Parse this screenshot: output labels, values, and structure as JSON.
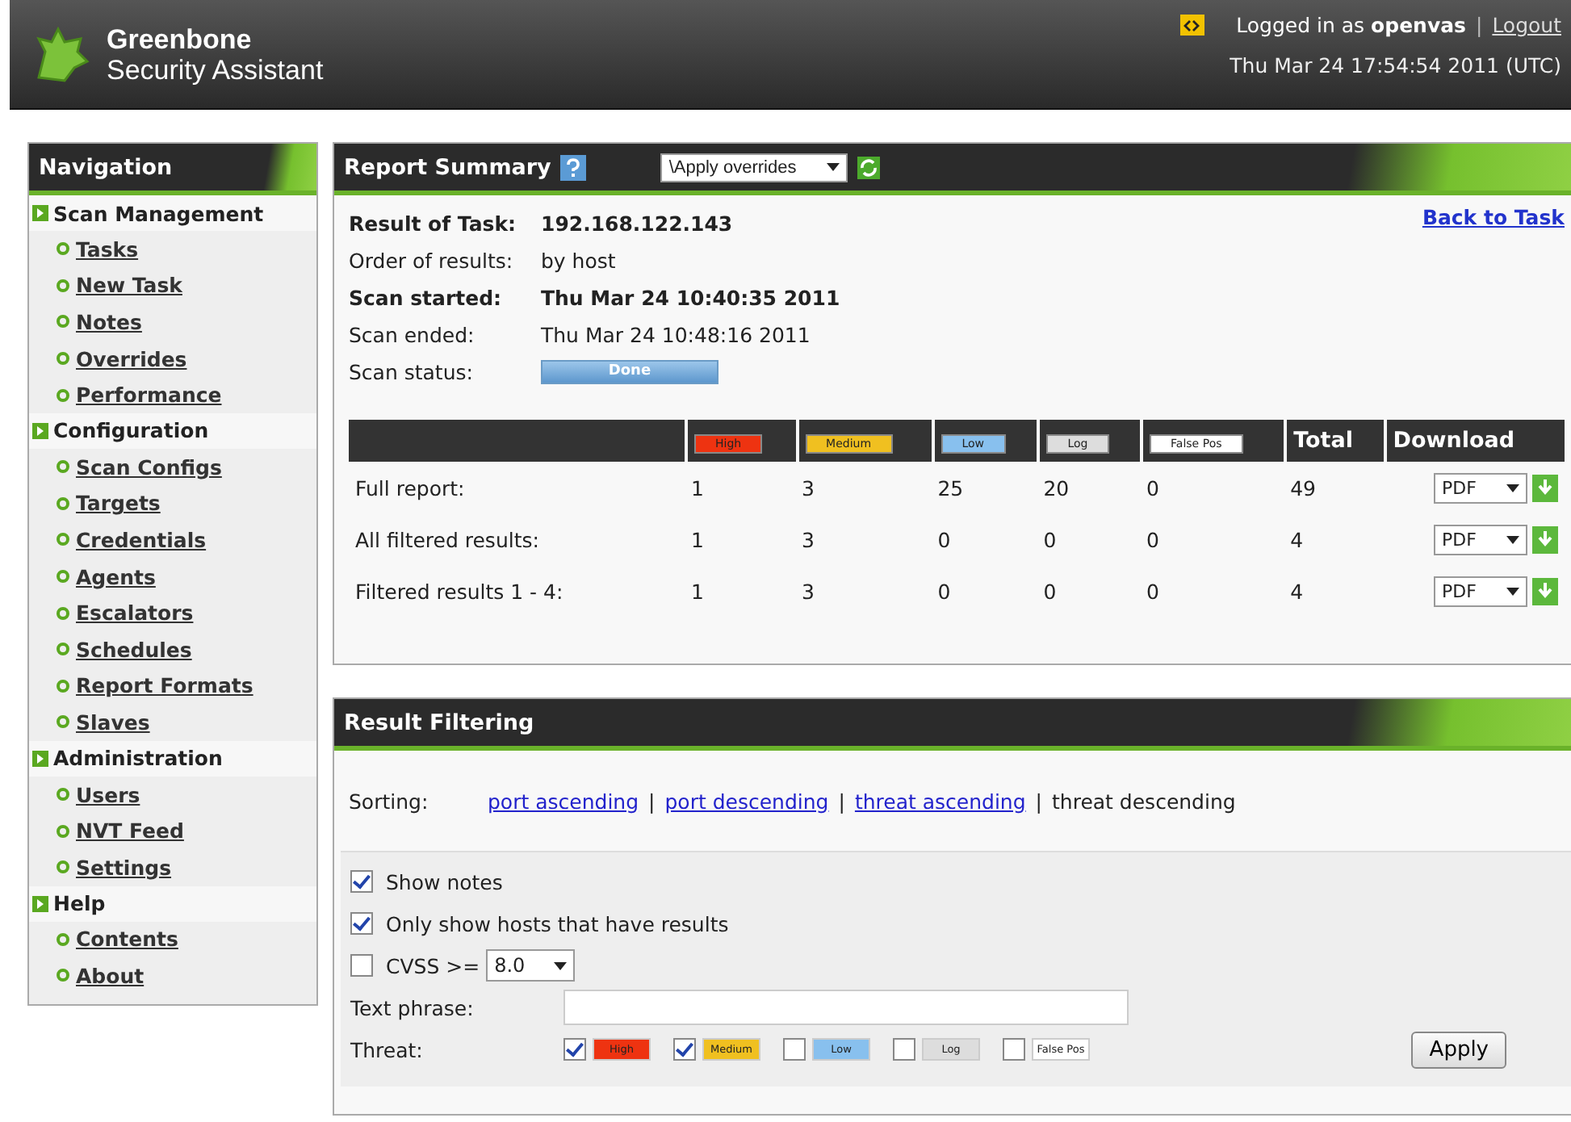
{
  "header": {
    "brand_line1": "Greenbone",
    "brand_line2": "Security Assistant",
    "logged_in_prefix": "Logged in as",
    "user": "openvas",
    "separator": "|",
    "logout": "Logout",
    "datetime": "Thu Mar 24 17:54:54 2011 (UTC)"
  },
  "navigation": {
    "title": "Navigation",
    "sections": [
      {
        "label": "Scan Management",
        "items": [
          "Tasks",
          "New Task",
          "Notes",
          "Overrides",
          "Performance"
        ]
      },
      {
        "label": "Configuration",
        "items": [
          "Scan Configs",
          "Targets",
          "Credentials",
          "Agents",
          "Escalators",
          "Schedules",
          "Report Formats",
          "Slaves"
        ]
      },
      {
        "label": "Administration",
        "items": [
          "Users",
          "NVT Feed",
          "Settings"
        ]
      },
      {
        "label": "Help",
        "items": [
          "Contents",
          "About"
        ]
      }
    ]
  },
  "report_summary": {
    "title": "Report Summary",
    "overrides_select": "\\Apply overrides",
    "back_link": "Back to Task",
    "info": [
      {
        "label": "Result of Task:",
        "value": "192.168.122.143",
        "bold": true
      },
      {
        "label": "Order of results:",
        "value": "by host",
        "bold": false
      },
      {
        "label": "Scan started:",
        "value": "Thu Mar 24 10:40:35 2011",
        "bold": true
      },
      {
        "label": "Scan ended:",
        "value": "Thu Mar 24 10:48:16 2011",
        "bold": false
      }
    ],
    "status_label": "Scan status:",
    "status": "Done",
    "severity_columns": [
      {
        "label": "High",
        "color": "#ee3311"
      },
      {
        "label": "Medium",
        "color": "#f0c020"
      },
      {
        "label": "Low",
        "color": "#88c0ee"
      },
      {
        "label": "Log",
        "color": "#dddddd"
      },
      {
        "label": "False Pos",
        "color": "#ffffff"
      }
    ],
    "total_header": "Total",
    "download_header": "Download",
    "rows": [
      {
        "label": "Full report:",
        "values": [
          "1",
          "3",
          "25",
          "20",
          "0"
        ],
        "total": "49",
        "format": "PDF"
      },
      {
        "label": "All filtered results:",
        "values": [
          "1",
          "3",
          "0",
          "0",
          "0"
        ],
        "total": "4",
        "format": "PDF"
      },
      {
        "label": "Filtered results 1 - 4:",
        "values": [
          "1",
          "3",
          "0",
          "0",
          "0"
        ],
        "total": "4",
        "format": "PDF"
      }
    ]
  },
  "result_filtering": {
    "title": "Result Filtering",
    "sorting_label": "Sorting:",
    "sort_options": [
      {
        "label": "port ascending",
        "selected": false
      },
      {
        "label": "port descending",
        "selected": false
      },
      {
        "label": "threat ascending",
        "selected": false
      },
      {
        "label": "threat descending",
        "selected": true
      }
    ],
    "sort_separator": "|",
    "show_notes": {
      "label": "Show notes",
      "checked": true
    },
    "only_hosts": {
      "label": "Only show hosts that have results",
      "checked": true
    },
    "cvss": {
      "label": "CVSS >=",
      "checked": false,
      "value": "8.0"
    },
    "text_phrase_label": "Text phrase:",
    "threat_label": "Threat:",
    "threats": [
      {
        "label": "High",
        "color": "#ee3311",
        "checked": true
      },
      {
        "label": "Medium",
        "color": "#f0c020",
        "checked": true
      },
      {
        "label": "Low",
        "color": "#88c0ee",
        "checked": false
      },
      {
        "label": "Log",
        "color": "#dddddd",
        "checked": false
      },
      {
        "label": "False Pos",
        "color": "#ffffff",
        "checked": false
      }
    ],
    "apply": "Apply"
  }
}
